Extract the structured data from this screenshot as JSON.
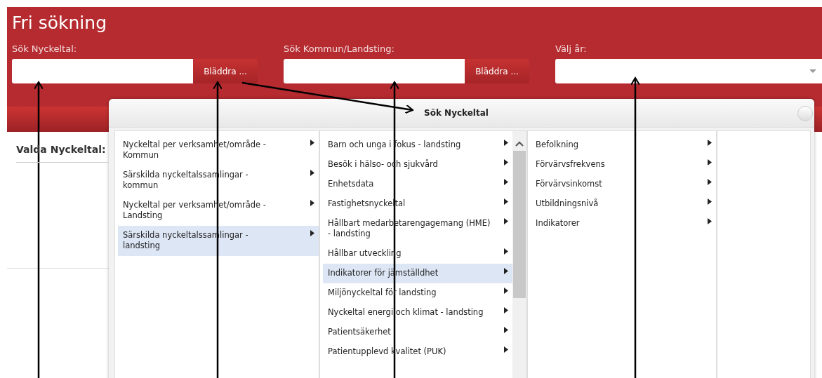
{
  "header": {
    "title": "Fri sökning"
  },
  "search_fields": [
    {
      "kind": "browse",
      "label": "Sök Nyckeltal:",
      "button": "Bläddra ..."
    },
    {
      "kind": "browse",
      "label": "Sök Kommun/Landsting:",
      "button": "Bläddra ..."
    },
    {
      "kind": "select",
      "label": "Välj år:"
    }
  ],
  "selected_panel": {
    "title": "Valda Nyckeltal:"
  },
  "dialog": {
    "title": "Sök Nyckeltal",
    "columns": [
      {
        "scrollable": false,
        "items": [
          {
            "label": "Nyckeltal per verksamhet/område - Kommun",
            "selected": false
          },
          {
            "label": "Särskilda nyckeltalssamlingar - kommun",
            "selected": false
          },
          {
            "label": "Nyckeltal per verksamhet/område - Landsting",
            "selected": false
          },
          {
            "label": "Särskilda nyckeltalssamlingar - landsting",
            "selected": true
          }
        ]
      },
      {
        "scrollable": true,
        "items": [
          {
            "label": "Barn och unga i fokus - landsting",
            "selected": false
          },
          {
            "label": "Besök i hälso- och sjukvård",
            "selected": false
          },
          {
            "label": "Enhetsdata",
            "selected": false
          },
          {
            "label": "Fastighetsnyckeltal",
            "selected": false
          },
          {
            "label": "Hållbart medarbetarengagemang (HME) - landsting",
            "selected": false
          },
          {
            "label": "Hållbar utveckling",
            "selected": false
          },
          {
            "label": "Indikatorer för jämställdhet",
            "selected": true
          },
          {
            "label": "Miljönyckeltal för landsting",
            "selected": false
          },
          {
            "label": "Nyckeltal energi och klimat - landsting",
            "selected": false
          },
          {
            "label": "Patientsäkerhet",
            "selected": false
          },
          {
            "label": "Patientupplevd kvalitet (PUK)",
            "selected": false
          }
        ]
      },
      {
        "scrollable": false,
        "items": [
          {
            "label": "Befolkning",
            "selected": false
          },
          {
            "label": "Förvärvsfrekvens",
            "selected": false
          },
          {
            "label": "Förvärvsinkomst",
            "selected": false
          },
          {
            "label": "Utbildningsnivå",
            "selected": false
          },
          {
            "label": "Indikatorer",
            "selected": false
          }
        ]
      }
    ]
  }
}
